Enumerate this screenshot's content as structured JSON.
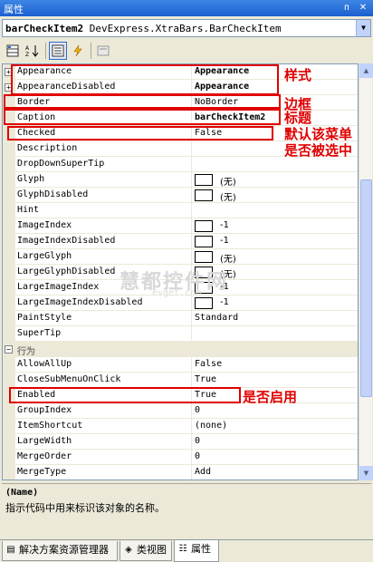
{
  "window": {
    "title": "属性",
    "pin": "ᴨ",
    "close": "✕"
  },
  "object_selector": {
    "name": "barCheckItem2",
    "type": " DevExpress.XtraBars.BarCheckItem"
  },
  "toolbar": {
    "categorized_icon": "grid-icon",
    "alphabetical_icon": "az-sort-icon",
    "properties_icon": "properties-icon",
    "events_icon": "lightning-icon",
    "pages_icon": "property-pages-icon"
  },
  "grid": {
    "rows": [
      {
        "name": "Appearance",
        "value": "Appearance",
        "bold": true,
        "expand": "+"
      },
      {
        "name": "AppearanceDisabled",
        "value": "Appearance",
        "bold": true,
        "expand": "+"
      },
      {
        "name": "Border",
        "value": "NoBorder"
      },
      {
        "name": "Caption",
        "value": "barCheckItem2",
        "bold": true
      },
      {
        "name": "Checked",
        "value": "False"
      },
      {
        "name": "Description",
        "value": ""
      },
      {
        "name": "DropDownSuperTip",
        "value": ""
      },
      {
        "name": "Glyph",
        "value": "(无)",
        "swatch": true
      },
      {
        "name": "GlyphDisabled",
        "value": "(无)",
        "swatch": true
      },
      {
        "name": "Hint",
        "value": ""
      },
      {
        "name": "ImageIndex",
        "value": "-1",
        "swatch": true
      },
      {
        "name": "ImageIndexDisabled",
        "value": "-1",
        "swatch": true
      },
      {
        "name": "LargeGlyph",
        "value": "(无)",
        "swatch": true
      },
      {
        "name": "LargeGlyphDisabled",
        "value": "(无)",
        "swatch": true
      },
      {
        "name": "LargeImageIndex",
        "value": "-1",
        "swatch": true
      },
      {
        "name": "LargeImageIndexDisabled",
        "value": "-1",
        "swatch": true
      },
      {
        "name": "PaintStyle",
        "value": "Standard"
      },
      {
        "name": "SuperTip",
        "value": ""
      },
      {
        "name": "行为",
        "category": true,
        "expand": "−"
      },
      {
        "name": "AllowAllUp",
        "value": "False"
      },
      {
        "name": "CloseSubMenuOnClick",
        "value": "True"
      },
      {
        "name": "Enabled",
        "value": "True"
      },
      {
        "name": "GroupIndex",
        "value": "0"
      },
      {
        "name": "ItemShortcut",
        "value": "(none)"
      },
      {
        "name": "LargeWidth",
        "value": "0"
      },
      {
        "name": "MergeOrder",
        "value": "0"
      },
      {
        "name": "MergeType",
        "value": "Add"
      }
    ]
  },
  "description": {
    "heading": "(Name)",
    "text": "指示代码中用来标识该对象的名称。"
  },
  "tabs": [
    {
      "label": "解决方案资源管理器",
      "icon": "solution-explorer-icon"
    },
    {
      "label": "类视图",
      "icon": "class-view-icon"
    },
    {
      "label": "属性",
      "icon": "properties-icon",
      "selected": true
    }
  ],
  "annotations": {
    "style": "样式",
    "border": "边框",
    "caption": "标题",
    "checked_line1": "默认该菜单",
    "checked_line2": "是否被选中",
    "enabled": "是否启用"
  },
  "watermark": {
    "text": "慧都控件网",
    "sub": "evget.com"
  }
}
